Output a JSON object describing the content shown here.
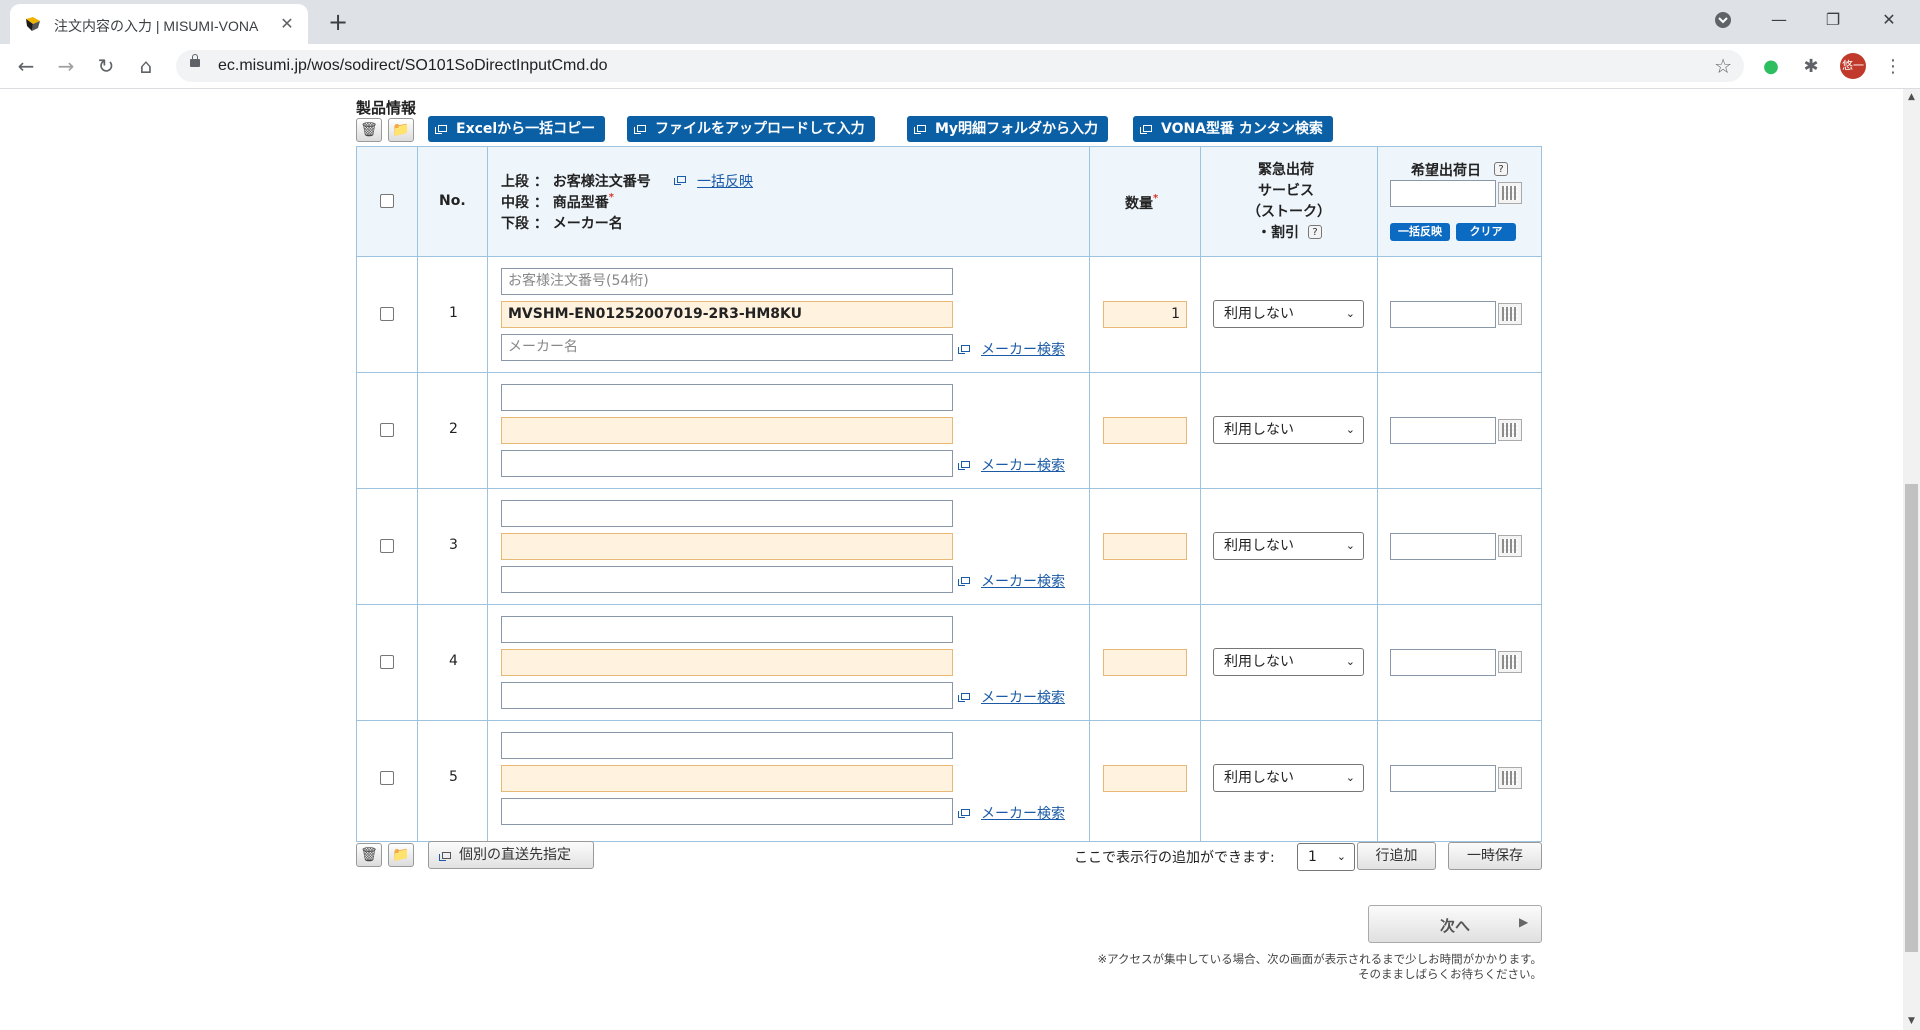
{
  "browser": {
    "tab_title": "注文内容の入力 | MISUMI-VONA",
    "url": "ec.misumi.jp/wos/sodirect/SO101SoDirectInputCmd.do",
    "avatar_text": "悠一"
  },
  "section": {
    "title": "製品情報"
  },
  "toolbar_buttons": [
    "Excelから一括コピー",
    "ファイルをアップロードして入力",
    "My明細フォルダから入力",
    "VONA型番 カンタン検索"
  ],
  "header": {
    "no": "No.",
    "line1_label": "上段 ： お客様注文番号",
    "line2_label": "中段 ： 商品型番",
    "line3_label": "下段 ： メーカー名",
    "bulk_apply_link": "一括反映",
    "quantity": "数量",
    "required_mark": "*",
    "urgent_line1": "緊急出荷",
    "urgent_line2": "サービス",
    "urgent_line3": "（ストーク）",
    "urgent_line4": "・割引",
    "help_mark": "?",
    "ship_date": "希望出荷日",
    "bulk_apply_btn": "一括反映",
    "clear_btn": "クリア"
  },
  "rows": [
    {
      "no": "1",
      "order_no_placeholder": "お客様注文番号(54桁)",
      "part_no": "MVSHM-EN01252007019-2R3-HM8KU",
      "maker_placeholder": "メーカー名",
      "quantity": "1",
      "urgent": "利用しない",
      "maker_search": "メーカー検索"
    },
    {
      "no": "2",
      "order_no_placeholder": "",
      "part_no": "",
      "maker_placeholder": "",
      "quantity": "",
      "urgent": "利用しない",
      "maker_search": "メーカー検索"
    },
    {
      "no": "3",
      "order_no_placeholder": "",
      "part_no": "",
      "maker_placeholder": "",
      "quantity": "",
      "urgent": "利用しない",
      "maker_search": "メーカー検索"
    },
    {
      "no": "4",
      "order_no_placeholder": "",
      "part_no": "",
      "maker_placeholder": "",
      "quantity": "",
      "urgent": "利用しない",
      "maker_search": "メーカー検索"
    },
    {
      "no": "5",
      "order_no_placeholder": "",
      "part_no": "",
      "maker_placeholder": "",
      "quantity": "",
      "urgent": "利用しない",
      "maker_search": "メーカー検索"
    }
  ],
  "footer": {
    "individual_ship_btn": "個別の直送先指定",
    "add_rows_label": "ここで表示行の追加ができます:",
    "add_rows_value": "1",
    "add_row_btn": "行追加",
    "temp_save_btn": "一時保存",
    "next_btn": "次へ",
    "notice_line1": "※アクセスが集中している場合、次の画面が表示されるまで少しお時間がかかります。",
    "notice_line2": "そのまましばらくお待ちください。"
  },
  "colors": {
    "primary_button": "#0b5fa5",
    "grid_border": "#9ec3de",
    "required_field_bg": "#fff3e0",
    "link": "#1a5aa6"
  }
}
